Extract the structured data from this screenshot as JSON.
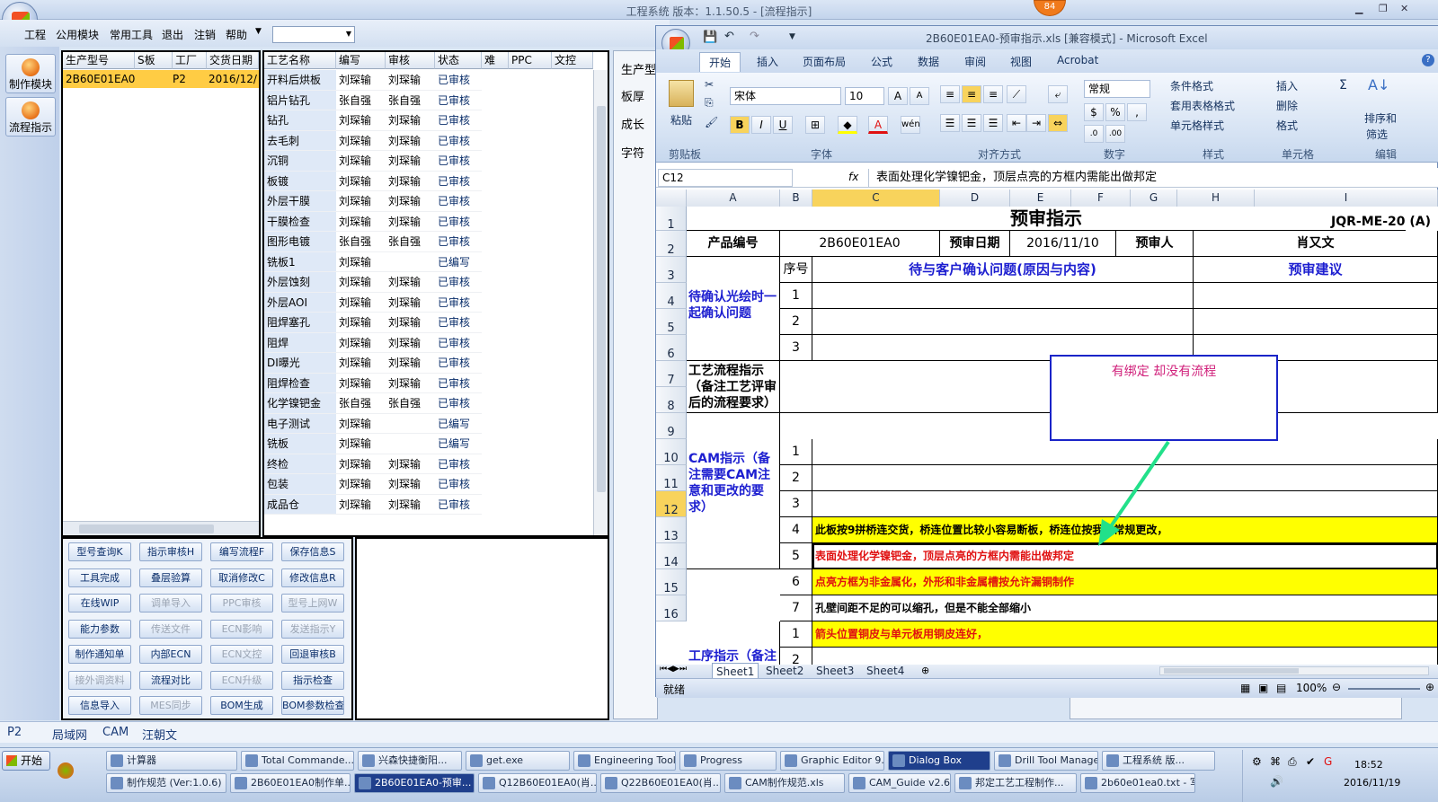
{
  "app": {
    "title": "工程系统  版本：1.1.50.5 - [流程指示]",
    "badge": "84"
  },
  "menu": [
    "工程",
    "公用模块",
    "常用工具",
    "退出",
    "注销",
    "帮助"
  ],
  "rail": [
    "制作模块",
    "流程指示"
  ],
  "model_grid": {
    "headers": [
      "生产型号",
      "S板",
      "工厂",
      "交货日期"
    ],
    "rows": [
      [
        "2B60E01EA0",
        "",
        "P2",
        "2016/12/"
      ]
    ]
  },
  "process_grid": {
    "headers": [
      "工艺名称",
      "编写",
      "审核",
      "状态",
      "难",
      "PPC",
      "文控"
    ],
    "rows": [
      [
        "开料后烘板",
        "刘琛输",
        "刘琛输",
        "已审核"
      ],
      [
        "铝片钻孔",
        "张自强",
        "张自强",
        "已审核"
      ],
      [
        "钻孔",
        "刘琛输",
        "刘琛输",
        "已审核"
      ],
      [
        "去毛刺",
        "刘琛输",
        "刘琛输",
        "已审核"
      ],
      [
        "沉铜",
        "刘琛输",
        "刘琛输",
        "已审核"
      ],
      [
        "板镀",
        "刘琛输",
        "刘琛输",
        "已审核"
      ],
      [
        "外层干膜",
        "刘琛输",
        "刘琛输",
        "已审核"
      ],
      [
        "干膜检查",
        "刘琛输",
        "刘琛输",
        "已审核"
      ],
      [
        "图形电镀",
        "张自强",
        "张自强",
        "已审核"
      ],
      [
        "铣板1",
        "刘琛输",
        "",
        "已编写"
      ],
      [
        "外层蚀刻",
        "刘琛输",
        "刘琛输",
        "已审核"
      ],
      [
        "外层AOI",
        "刘琛输",
        "刘琛输",
        "已审核"
      ],
      [
        "阻焊塞孔",
        "刘琛输",
        "刘琛输",
        "已审核"
      ],
      [
        "阻焊",
        "刘琛输",
        "刘琛输",
        "已审核"
      ],
      [
        "DI曝光",
        "刘琛输",
        "刘琛输",
        "已审核"
      ],
      [
        "阻焊检查",
        "刘琛输",
        "刘琛输",
        "已审核"
      ],
      [
        "化学镍钯金",
        "张自强",
        "张自强",
        "已审核"
      ],
      [
        "电子测试",
        "刘琛输",
        "",
        "已编写"
      ],
      [
        "铣板",
        "刘琛输",
        "",
        "已编写"
      ],
      [
        "终检",
        "刘琛输",
        "刘琛输",
        "已审核"
      ],
      [
        "包装",
        "刘琛输",
        "刘琛输",
        "已审核"
      ],
      [
        "成品仓",
        "刘琛输",
        "刘琛输",
        "已审核"
      ]
    ]
  },
  "buttons": [
    [
      "型号查询K",
      "指示审核H",
      "编写流程F",
      "保存信息S"
    ],
    [
      "工具完成",
      "叠层验算",
      "取消修改C",
      "修改信息R"
    ],
    [
      "在线WIP",
      "调单导入",
      "PPC审核",
      "型号上网W"
    ],
    [
      "能力参数",
      "传送文件",
      "ECN影响",
      "发送指示Y"
    ],
    [
      "制作通知单",
      "内部ECN",
      "ECN文控",
      "回退审核B"
    ],
    [
      "接外调资料",
      "流程对比",
      "ECN升级",
      "指示检查"
    ],
    [
      "信息导入",
      "MES同步",
      "BOM生成",
      "BOM参数检查"
    ]
  ],
  "disabled_buttons": [
    "调单导入",
    "PPC审核",
    "型号上网W",
    "传送文件",
    "ECN影响",
    "发送指示Y",
    "ECN文控",
    "接外调资料",
    "ECN升级",
    "MES同步"
  ],
  "right_labels": [
    "生产型",
    "板厚",
    "成长",
    "字符"
  ],
  "excel": {
    "title": "2B60E01EA0-预审指示.xls  [兼容模式] - Microsoft Excel",
    "tabs": [
      "开始",
      "插入",
      "页面布局",
      "公式",
      "数据",
      "审阅",
      "视图",
      "Acrobat"
    ],
    "font": "宋体",
    "size": "10",
    "numfmt": "常规",
    "groups": [
      "剪贴板",
      "字体",
      "对齐方式",
      "数字",
      "样式",
      "单元格",
      "编辑"
    ],
    "ribbon": {
      "paste": "粘贴",
      "cond": "条件格式",
      "table": "套用表格格式",
      "cellstyle": "单元格样式",
      "insert": "插入",
      "delete": "删除",
      "format": "格式",
      "sort": "排序和",
      "find": "筛选",
      "pct": "%"
    },
    "cellref": "C12",
    "fx": "fx",
    "formula": "表面处理化学镍钯金，顶层点亮的方框内需能出做邦定",
    "cols": [
      "A",
      "B",
      "C",
      "D",
      "E",
      "F",
      "G",
      "H",
      "I"
    ],
    "rows": [
      "1",
      "2",
      "3",
      "4",
      "5",
      "6",
      "7",
      "8",
      "9",
      "10",
      "11",
      "12",
      "13",
      "14",
      "15",
      "16"
    ],
    "sheet": {
      "title": "预审指示",
      "code": "JQR-ME-20 (A)",
      "prod_label": "产品编号",
      "prod": "2B60E01EA0",
      "date_label": "预审日期",
      "date": "2016/11/10",
      "rev_label": "预审人",
      "rev": "肖又文",
      "seq": "序号",
      "issue": "待与客户确认问题(原因与内容)",
      "advice": "预审建议",
      "s1": "待确认光绘时一起确认问题",
      "s2": "工艺流程指示（备注工艺评审后的流程要求）",
      "s3": "CAM指示（备注需要CAM注意和更改的要求）",
      "s4": "工序指示（备注需要CAM转",
      "n": [
        "1",
        "2",
        "3",
        "1",
        "2",
        "3",
        "4",
        "5",
        "6",
        "7",
        "1",
        "2"
      ],
      "cam4": "此板按9拼桥连交货，桥连位置比较小容易断板，桥连位按我司常规更改，",
      "cam5": "表面处理化学镍钯金，顶层点亮的方框内需能出做邦定",
      "cam6": "点亮方框为非金属化，外形和非金属槽按允许漏铜制作",
      "cam7": "孔壁间距不足的可以缩孔，但是不能全部缩小",
      "op1": "箭头位置铜皮与单元板用铜皮连好，"
    },
    "annotation": "有绑定  却没有流程",
    "sheets": [
      "Sheet1",
      "Sheet2",
      "Sheet3",
      "Sheet4"
    ],
    "status": "就绪",
    "zoom": "100%"
  },
  "subbar": [
    "P2",
    "局域网",
    "CAM",
    "汪朝文"
  ],
  "taskbar": {
    "start": "开始",
    "row1": [
      "计算器",
      "Total Commande...",
      "兴森快捷衡阳...",
      "get.exe",
      "Engineering Tool...",
      "Progress",
      "Graphic Editor 9...",
      "Dialog Box",
      "Drill Tool Manager",
      "工程系统  版..."
    ],
    "row2": [
      "制作规范 (Ver:1.0.6)",
      "2B60E01EA0制作单...",
      "2B60E01EA0-预审...",
      "Q12B60E01EA0(肖...",
      "Q22B60E01EA0(肖...",
      "CAM制作规范.xls",
      "CAM_Guide v2.63",
      "邦定工艺工程制作...",
      "2b60e01ea0.txt - 写..."
    ],
    "time": "18:52",
    "date": "2016/11/19"
  },
  "colors": {
    "accent": "#1d1fd0",
    "highlight": "#ffff00",
    "red_text": "#e01010",
    "arrow": "#22e08a"
  }
}
